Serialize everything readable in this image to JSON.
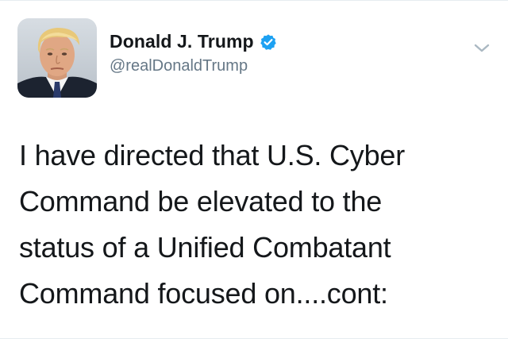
{
  "tweet": {
    "author": {
      "display_name": "Donald J. Trump",
      "handle": "@realDonaldTrump",
      "verified": true,
      "avatar_icon": "profile-photo"
    },
    "text": "I have directed that U.S. Cyber\nCommand be elevated to the\nstatus of a Unified Combatant\nCommand focused on....cont:",
    "menu_icon": "chevron-down-icon"
  },
  "colors": {
    "verified_badge": "#1da1f2",
    "handle": "#657786",
    "text": "#14171a",
    "caret": "#aab8c2"
  }
}
